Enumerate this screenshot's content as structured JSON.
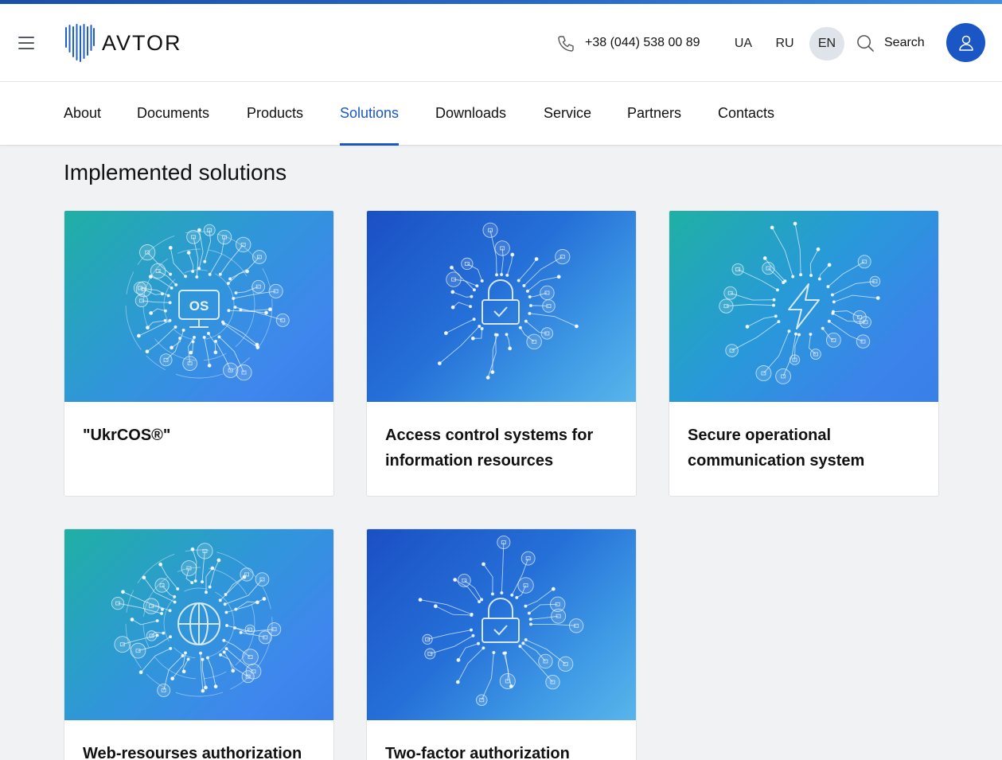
{
  "header": {
    "brand": "AVTOR",
    "phone": "+38 (044) 538 00 89",
    "languages": [
      "UA",
      "RU",
      "EN"
    ],
    "active_language": "EN",
    "search_label": "Search"
  },
  "nav": {
    "items": [
      "About",
      "Documents",
      "Products",
      "Solutions",
      "Downloads",
      "Service",
      "Partners",
      "Contacts"
    ],
    "active": "Solutions"
  },
  "main": {
    "title": "Implemented solutions",
    "cards": [
      {
        "title": "\"UkrCOS®\"",
        "image": "os-monitor-network",
        "center_label": "OS"
      },
      {
        "title": "Access control systems for information resources",
        "image": "padlock-network"
      },
      {
        "title": "Secure operational communication system",
        "image": "lightning-network"
      },
      {
        "title": "Web-resourses authorization",
        "image": "globe-network"
      },
      {
        "title": "Two-factor authorization",
        "image": "padlock-network"
      }
    ]
  },
  "colors": {
    "accent": "#1a57c4",
    "background": "#f1f2f4",
    "avatar": "#1a57c4"
  },
  "icons": [
    "menu-icon",
    "avtor-logo",
    "phone-icon",
    "search-icon",
    "user-icon"
  ]
}
